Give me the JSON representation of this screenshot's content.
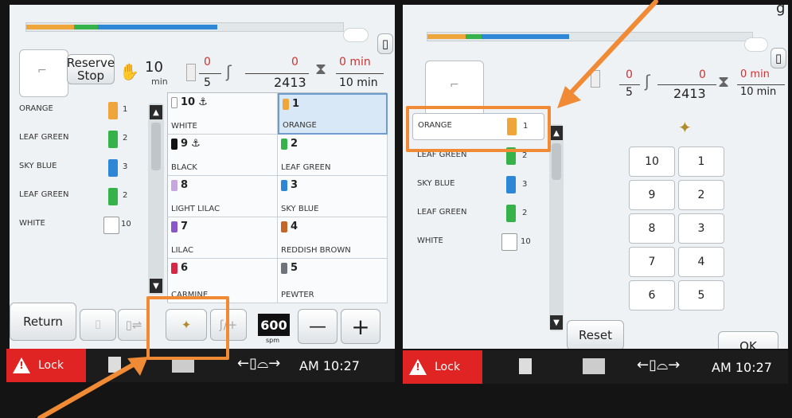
{
  "left": {
    "reserve_stop": "Reserve\nStop",
    "time_val": "10",
    "time_unit": "min",
    "stitch_num": "0",
    "stitch_den": "5",
    "count_num": "0",
    "count_den": "2413",
    "min_top": "0 min",
    "min_bot": "10 min",
    "thread_list": [
      {
        "name": "ORANGE",
        "num": "1",
        "color": "#f0a53b"
      },
      {
        "name": "LEAF GREEN",
        "num": "2",
        "color": "#35b34a"
      },
      {
        "name": "SKY BLUE",
        "num": "3",
        "color": "#2e86d6"
      },
      {
        "name": "LEAF GREEN",
        "num": "2",
        "color": "#35b34a"
      },
      {
        "name": "WHITE",
        "num": "10",
        "color": "#ffffff"
      }
    ],
    "grid_left": [
      {
        "num": "10",
        "name": "WHITE",
        "color": "#ffffff",
        "anchor": "⚓"
      },
      {
        "num": "9",
        "name": "BLACK",
        "color": "#111111",
        "anchor": "⚓"
      },
      {
        "num": "8",
        "name": "LIGHT LILAC",
        "color": "#c5a6df",
        "anchor": ""
      },
      {
        "num": "7",
        "name": "LILAC",
        "color": "#8b56c9",
        "anchor": ""
      },
      {
        "num": "6",
        "name": "CARMINE",
        "color": "#d62846",
        "anchor": ""
      }
    ],
    "grid_right": [
      {
        "num": "1",
        "name": "ORANGE",
        "color": "#f0a53b"
      },
      {
        "num": "2",
        "name": "LEAF GREEN",
        "color": "#35b34a"
      },
      {
        "num": "3",
        "name": "SKY BLUE",
        "color": "#2e86d6"
      },
      {
        "num": "4",
        "name": "REDDISH BROWN",
        "color": "#c4652a"
      },
      {
        "num": "5",
        "name": "PEWTER",
        "color": "#6e7479"
      }
    ],
    "return": "Return",
    "speed": "600",
    "speed_unit": "spm",
    "minus": "—",
    "plus": "+",
    "lock": "Lock",
    "time": "AM 10:27"
  },
  "right": {
    "stitch_num": "0",
    "stitch_den": "5",
    "count_num": "0",
    "count_den": "2413",
    "min_top": "0 min",
    "min_bot": "10 min",
    "thread_list": [
      {
        "name": "ORANGE",
        "num": "1",
        "color": "#f0a53b"
      },
      {
        "name": "LEAF GREEN",
        "num": "2",
        "color": "#35b34a"
      },
      {
        "name": "SKY BLUE",
        "num": "3",
        "color": "#2e86d6"
      },
      {
        "name": "LEAF GREEN",
        "num": "2",
        "color": "#35b34a"
      },
      {
        "name": "WHITE",
        "num": "10",
        "color": "#ffffff"
      }
    ],
    "numpad_left": [
      "10",
      "9",
      "8",
      "7",
      "6"
    ],
    "numpad_right": [
      "1",
      "2",
      "3",
      "4",
      "5"
    ],
    "reset": "Reset",
    "ok": "OK",
    "lock": "Lock",
    "time": "AM 10:27"
  },
  "annotation": {
    "corner_text": "g"
  }
}
